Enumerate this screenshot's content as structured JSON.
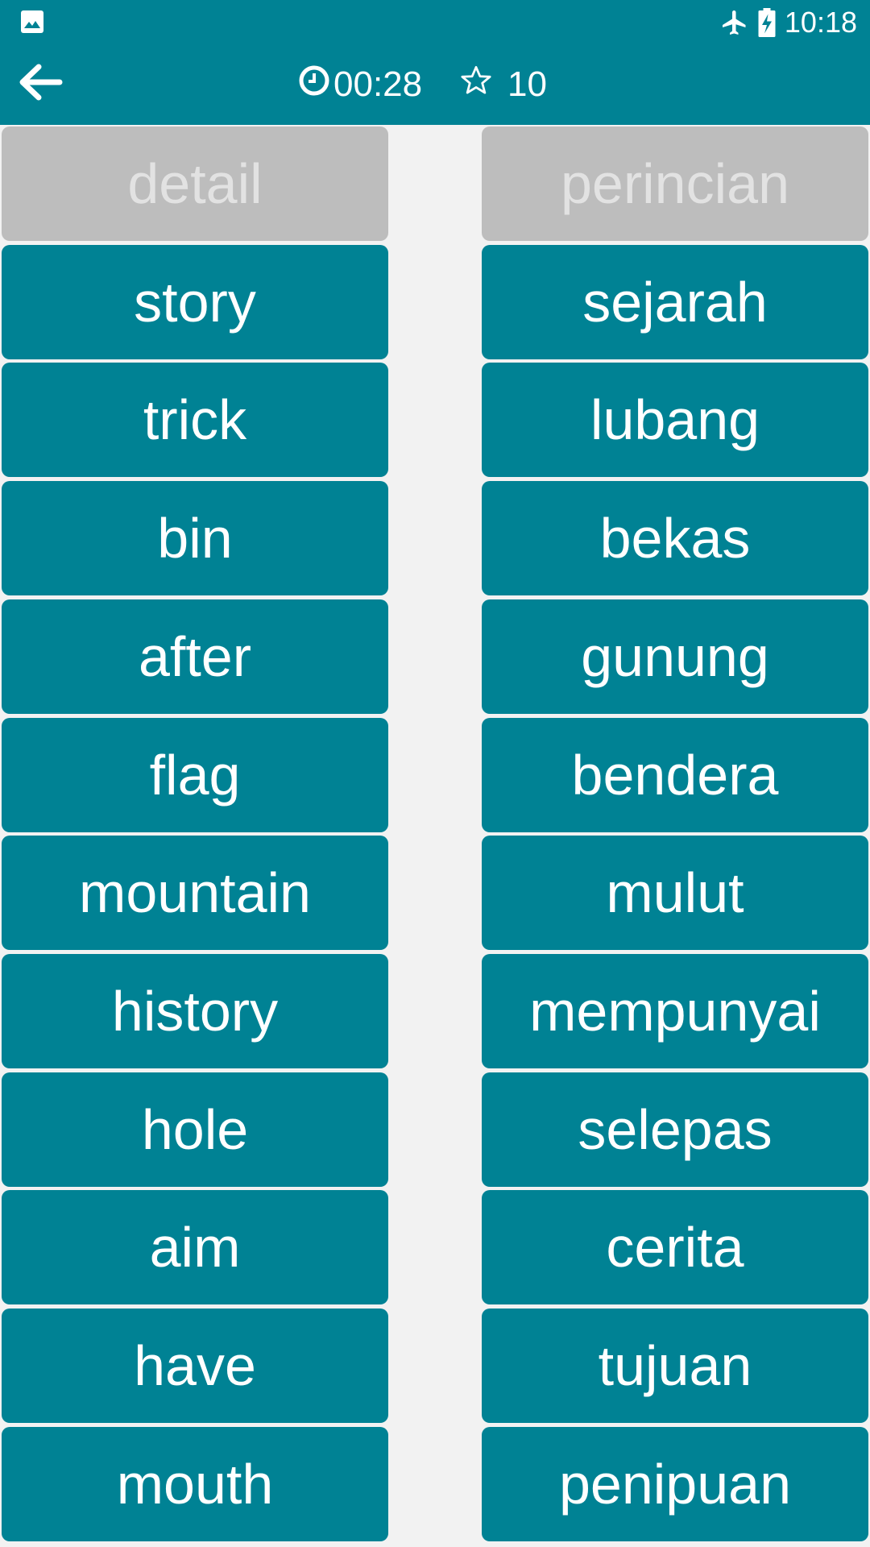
{
  "status_bar": {
    "time": "10:18",
    "icons": [
      "image-notification-icon",
      "airplane-mode-icon",
      "battery-charging-icon"
    ]
  },
  "header": {
    "back_icon": "arrow-left-icon",
    "timer_icon": "clock-icon",
    "timer": "00:28",
    "score_icon": "star-outline-icon",
    "score": "10"
  },
  "colors": {
    "primary": "#008294",
    "matched_tile": "#bdbdbd",
    "matched_text": "#e2e2e2",
    "background": "#f2f2f2"
  },
  "left_words": [
    {
      "text": "detail",
      "matched": true
    },
    {
      "text": "story",
      "matched": false
    },
    {
      "text": "trick",
      "matched": false
    },
    {
      "text": "bin",
      "matched": false
    },
    {
      "text": "after",
      "matched": false
    },
    {
      "text": "flag",
      "matched": false
    },
    {
      "text": "mountain",
      "matched": false
    },
    {
      "text": "history",
      "matched": false
    },
    {
      "text": "hole",
      "matched": false
    },
    {
      "text": "aim",
      "matched": false
    },
    {
      "text": "have",
      "matched": false
    },
    {
      "text": "mouth",
      "matched": false
    }
  ],
  "right_words": [
    {
      "text": "perincian",
      "matched": true
    },
    {
      "text": "sejarah",
      "matched": false
    },
    {
      "text": "lubang",
      "matched": false
    },
    {
      "text": "bekas",
      "matched": false
    },
    {
      "text": "gunung",
      "matched": false
    },
    {
      "text": "bendera",
      "matched": false
    },
    {
      "text": "mulut",
      "matched": false
    },
    {
      "text": "mempunyai",
      "matched": false
    },
    {
      "text": "selepas",
      "matched": false
    },
    {
      "text": "cerita",
      "matched": false
    },
    {
      "text": "tujuan",
      "matched": false
    },
    {
      "text": "penipuan",
      "matched": false
    }
  ]
}
